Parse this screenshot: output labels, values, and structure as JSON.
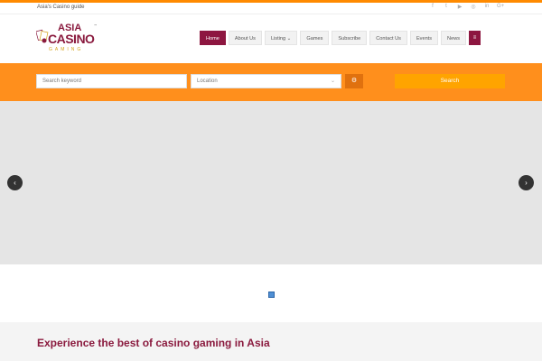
{
  "topbar": {
    "tagline": "Asia's Casino guide",
    "socials": [
      {
        "icon": "facebook-icon",
        "glyph": "f"
      },
      {
        "icon": "twitter-icon",
        "glyph": "t"
      },
      {
        "icon": "youtube-icon",
        "glyph": "▶"
      },
      {
        "icon": "instagram-icon",
        "glyph": "◎"
      },
      {
        "icon": "linkedin-icon",
        "glyph": "in"
      },
      {
        "icon": "google-plus-icon",
        "glyph": "G+"
      }
    ]
  },
  "logo": {
    "line1": "ASIA",
    "line2": "CASINO",
    "line3": "GAMING",
    "tm": "™"
  },
  "nav": {
    "items": [
      {
        "label": "Home"
      },
      {
        "label": "About Us"
      },
      {
        "label": "Listing ⌄"
      },
      {
        "label": "Games"
      },
      {
        "label": "Subscribe"
      },
      {
        "label": "Contact Us"
      },
      {
        "label": "Events"
      },
      {
        "label": "News"
      }
    ],
    "menu_glyph": "≡"
  },
  "search": {
    "keyword_placeholder": "Search keyword",
    "location_placeholder": "Location",
    "location_caret": "⌄",
    "gear_glyph": "⚙",
    "button_label": "Search"
  },
  "slider": {
    "prev_glyph": "‹",
    "next_glyph": "›"
  },
  "main": {
    "headline": "Experience the best of casino gaming in Asia"
  },
  "colors": {
    "accent": "#8d1640",
    "orange": "#ff8f1c",
    "button": "#ffa400"
  }
}
